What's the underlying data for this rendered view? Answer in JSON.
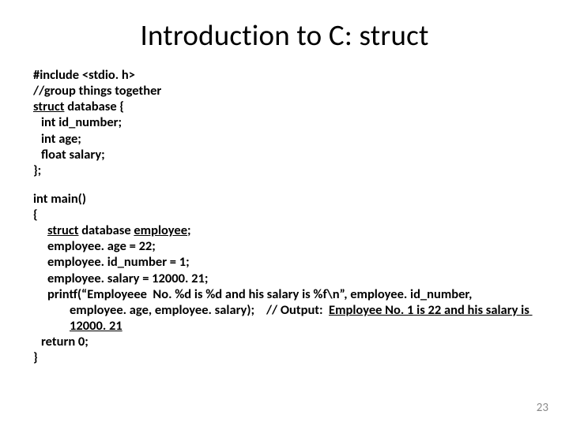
{
  "title": "Introduction to C: struct",
  "code": {
    "l1": "#include <stdio. h>",
    "l2": "//group things together",
    "l3_kw": "struct",
    "l3_rest": " database {",
    "l4": "int id_number;",
    "l5": "int age;",
    "l6": "float salary;",
    "l7": "};",
    "l8": "int main()",
    "l9": "{",
    "l10_kw": "struct",
    "l10_mid": " database ",
    "l10_emp": "employee",
    "l10_end": ";",
    "l11": "employee. age = 22;",
    "l12": "employee. id_number = 1;",
    "l13": "employee. salary = 12000. 21;",
    "l14_a": "printf(“Employeee  No. %d is %d and his salary is %f\\n”, employee. id_number,",
    "l14_b": "employee. age, employee. salary);    // Output:  ",
    "l14_c": "Employee No. 1 is 22 and his salary is 12000. 21",
    "l15": "return 0;",
    "l16": "}"
  },
  "page_number": "23"
}
